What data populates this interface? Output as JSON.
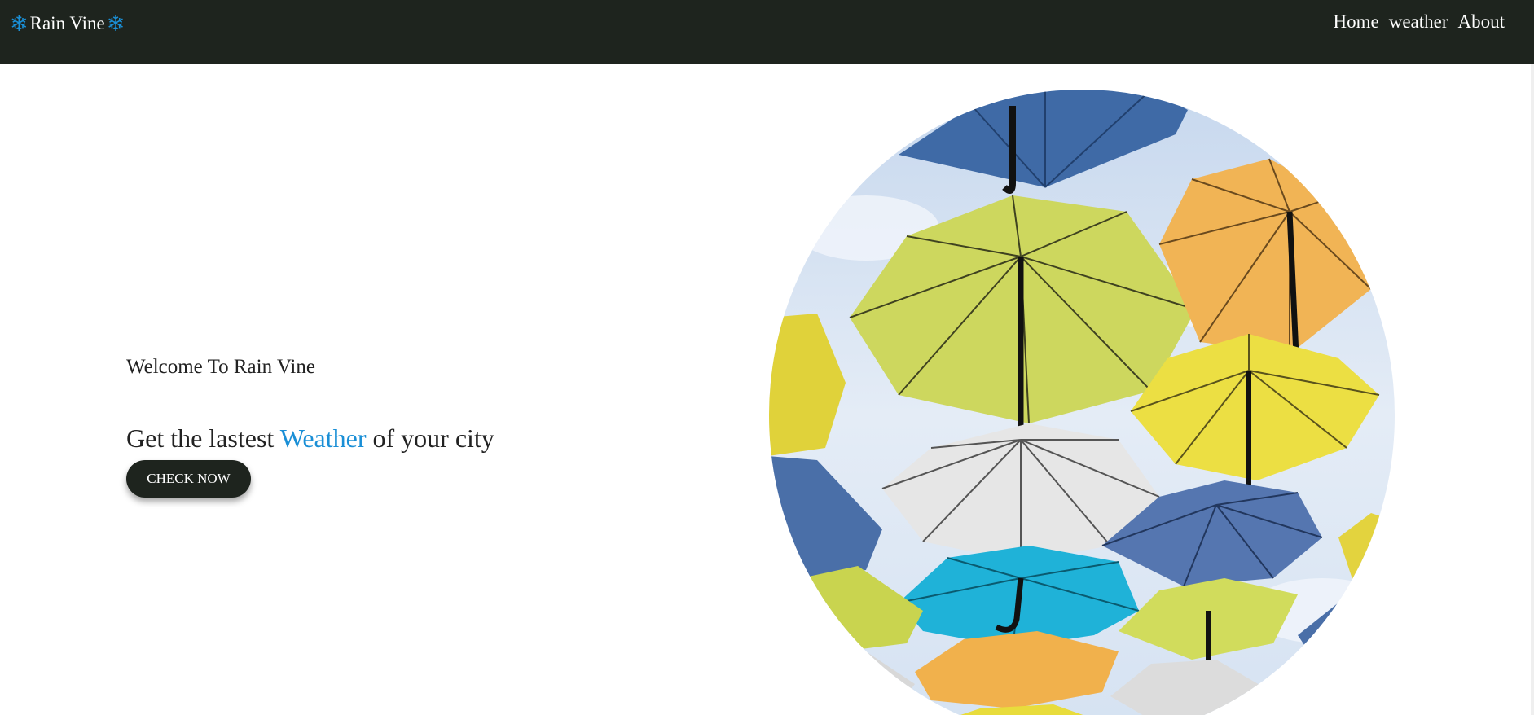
{
  "brand": {
    "name": "Rain Vine",
    "icon": "snowflake-icon",
    "icon_glyph": "❄",
    "icon_color": "#1a8fd6"
  },
  "nav": {
    "items": [
      "Home",
      "weather",
      "About"
    ]
  },
  "hero": {
    "welcome": "Welcome To Rain Vine",
    "heading_prefix": "Get the lastest ",
    "heading_accent": "Weather",
    "heading_suffix": " of your city",
    "cta_label": "CHECK NOW"
  },
  "image": {
    "subject": "umbrella-photo"
  },
  "colors": {
    "navbar": "#1e241e",
    "accent": "#1a8fd6",
    "text": "#222222"
  }
}
